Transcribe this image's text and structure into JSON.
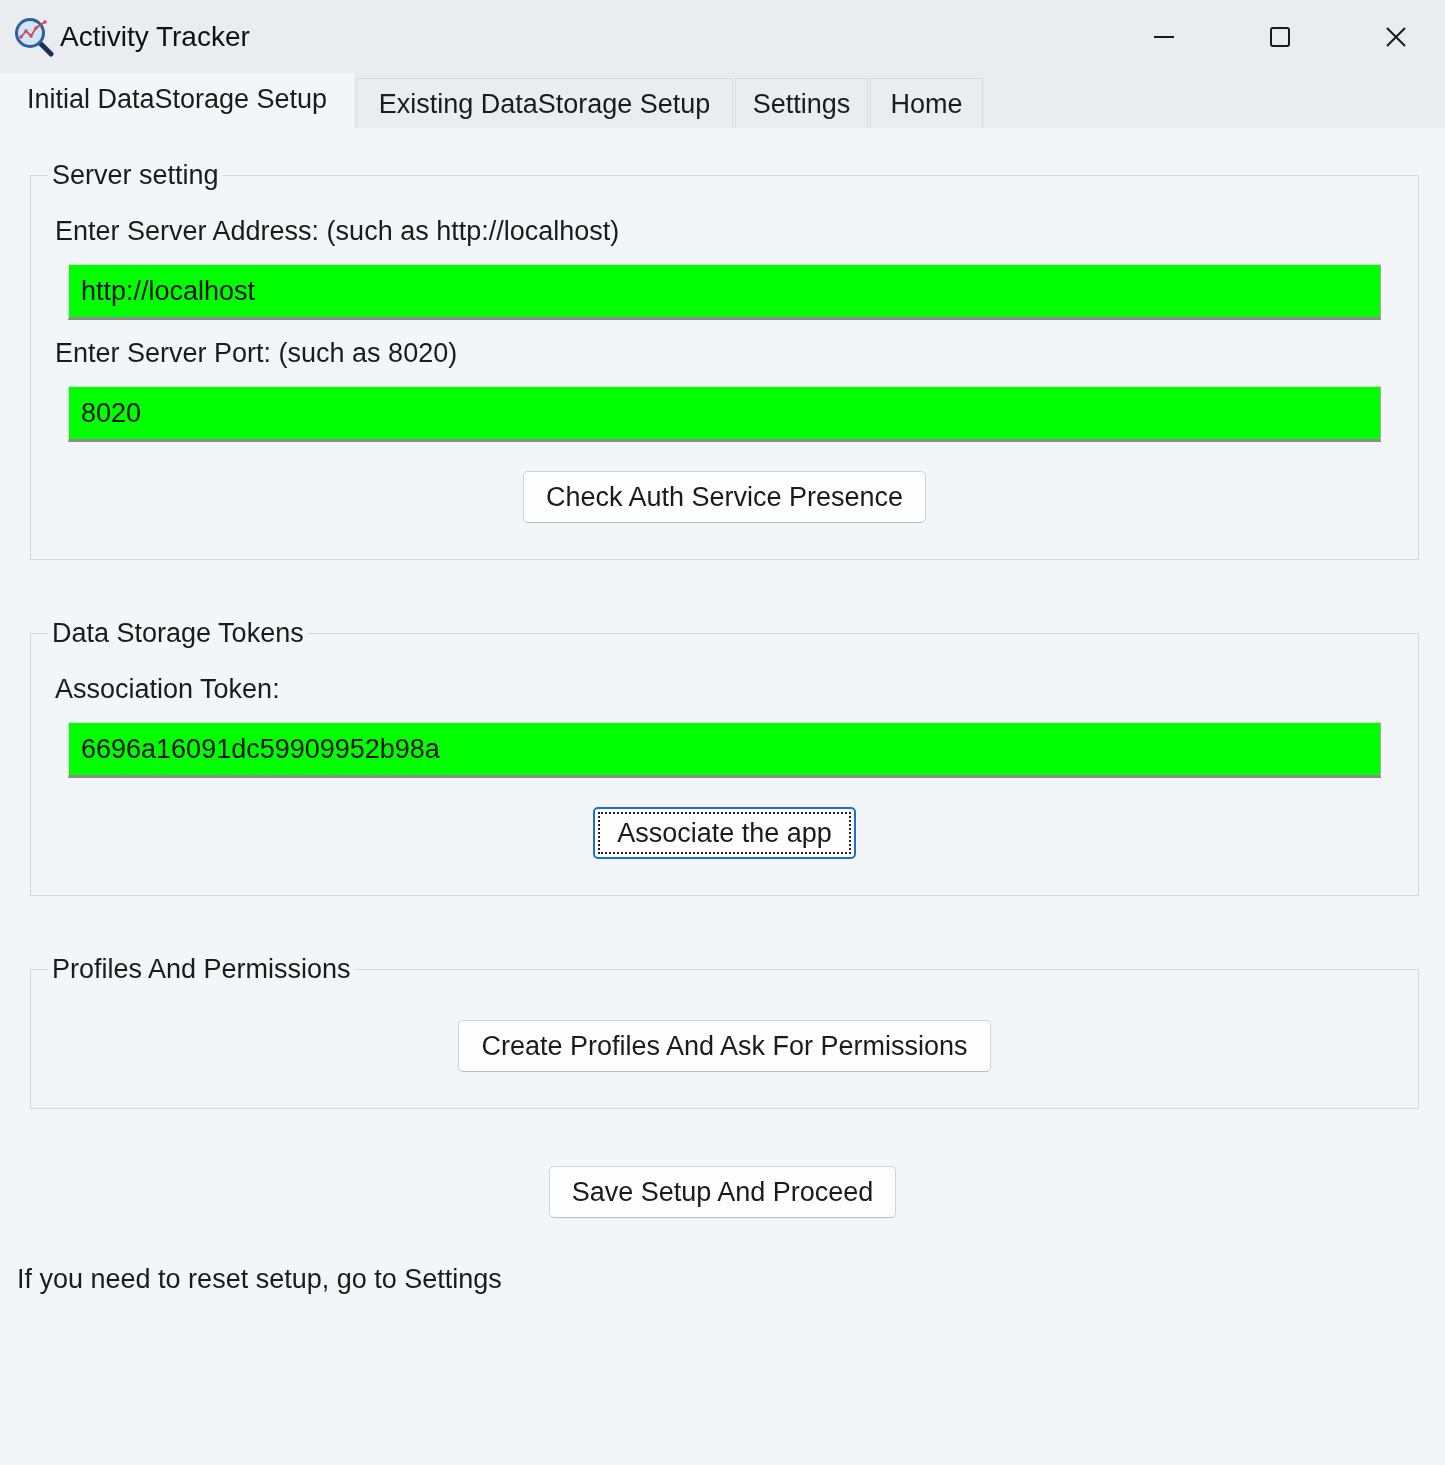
{
  "window": {
    "title": "Activity Tracker"
  },
  "tabs": [
    {
      "label": "Initial DataStorage Setup",
      "selected": true
    },
    {
      "label": "Existing DataStorage Setup",
      "selected": false
    },
    {
      "label": "Settings",
      "selected": false
    },
    {
      "label": "Home",
      "selected": false
    }
  ],
  "groups": [
    {
      "title": "Server setting",
      "items": [
        {
          "kind": "label",
          "text": "Enter Server Address: (such as http://localhost)"
        },
        {
          "kind": "field",
          "value": "http://localhost",
          "valid": true
        },
        {
          "kind": "label",
          "text": "Enter Server Port: (such as 8020)"
        },
        {
          "kind": "field",
          "value": "8020",
          "valid": true
        },
        {
          "kind": "button",
          "label": "Check Auth Service Presence",
          "focused": false
        }
      ]
    },
    {
      "title": "Data Storage Tokens",
      "items": [
        {
          "kind": "label",
          "text": "Association Token:"
        },
        {
          "kind": "field",
          "value": "6696a16091dc59909952b98a",
          "valid": true
        },
        {
          "kind": "button",
          "label": "Associate the app",
          "focused": true
        }
      ]
    },
    {
      "title": "Profiles And Permissions",
      "items": [
        {
          "kind": "button",
          "label": "Create Profiles And Ask For Permissions",
          "focused": false
        }
      ]
    }
  ],
  "buttons": [
    {
      "label": "Save Setup And Proceed",
      "focused": false
    }
  ],
  "footer_note": "If you need to reset setup, go to Settings"
}
